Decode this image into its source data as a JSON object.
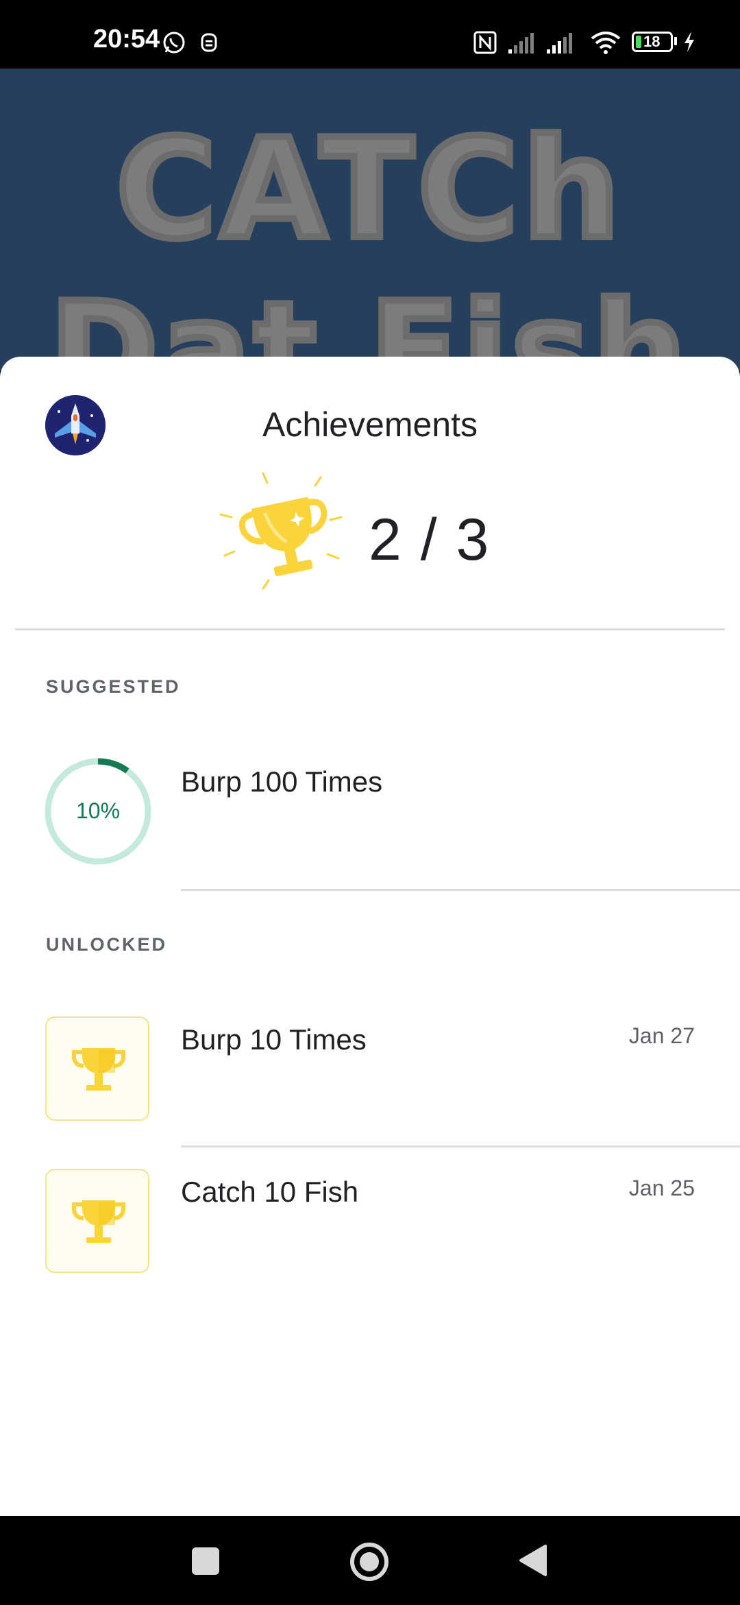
{
  "status_bar": {
    "time": "20:54",
    "battery": "18"
  },
  "background_game": {
    "title_line1": "CATCh",
    "title_line2": "Dat Fish"
  },
  "sheet": {
    "title": "Achievements",
    "score": "2 / 3"
  },
  "suggested": {
    "label": "SUGGESTED",
    "items": [
      {
        "title": "Burp 100 Times",
        "progress_text": "10%",
        "progress": 0.1
      }
    ]
  },
  "unlocked": {
    "label": "UNLOCKED",
    "items": [
      {
        "title": "Burp 10 Times",
        "date": "Jan 27"
      },
      {
        "title": "Catch 10 Fish",
        "date": "Jan 25"
      }
    ]
  },
  "colors": {
    "progress_fg": "#137a52",
    "progress_bg": "#c4eadb",
    "trophy": "#fbd33a",
    "badge_border": "#f5e387"
  },
  "icons": {
    "status": [
      "whatsapp-icon",
      "notification-icon",
      "nfc-icon",
      "signal-icon",
      "wifi-icon",
      "battery-icon",
      "charging-icon"
    ],
    "nav": [
      "recent-apps-icon",
      "home-icon",
      "back-icon"
    ]
  }
}
